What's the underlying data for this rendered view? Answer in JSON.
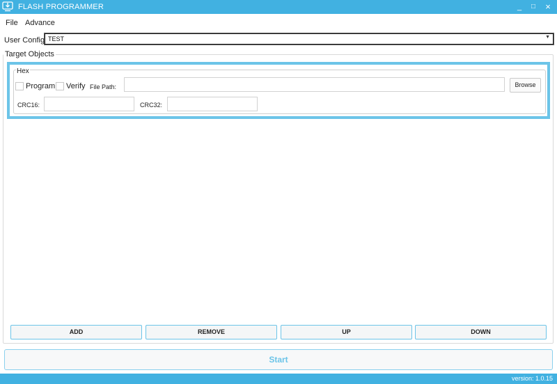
{
  "titlebar": {
    "title": "FLASH PROGRAMMER",
    "minimize": "_",
    "maximize": "□",
    "close": "×"
  },
  "menu": {
    "file": "File",
    "advance": "Advance"
  },
  "user_config": {
    "label": "User Config:",
    "value": "TEST"
  },
  "target_objects": {
    "legend": "Target Objects",
    "items": [
      {
        "legend": "Hex",
        "program_label": "Program",
        "program_checked": false,
        "verify_label": "Verify",
        "verify_checked": false,
        "file_path_label": "File Path:",
        "file_path_value": "",
        "browse_label": "Browse",
        "crc16_label": "CRC16:",
        "crc16_value": "",
        "crc32_label": "CRC32:",
        "crc32_value": ""
      }
    ]
  },
  "actions": {
    "add": "ADD",
    "remove": "REMOVE",
    "up": "UP",
    "down": "DOWN"
  },
  "start_label": "Start",
  "status": {
    "version": "version: 1.0.15"
  },
  "colors": {
    "accent": "#41b1e1",
    "highlight": "#6cc4e8"
  }
}
